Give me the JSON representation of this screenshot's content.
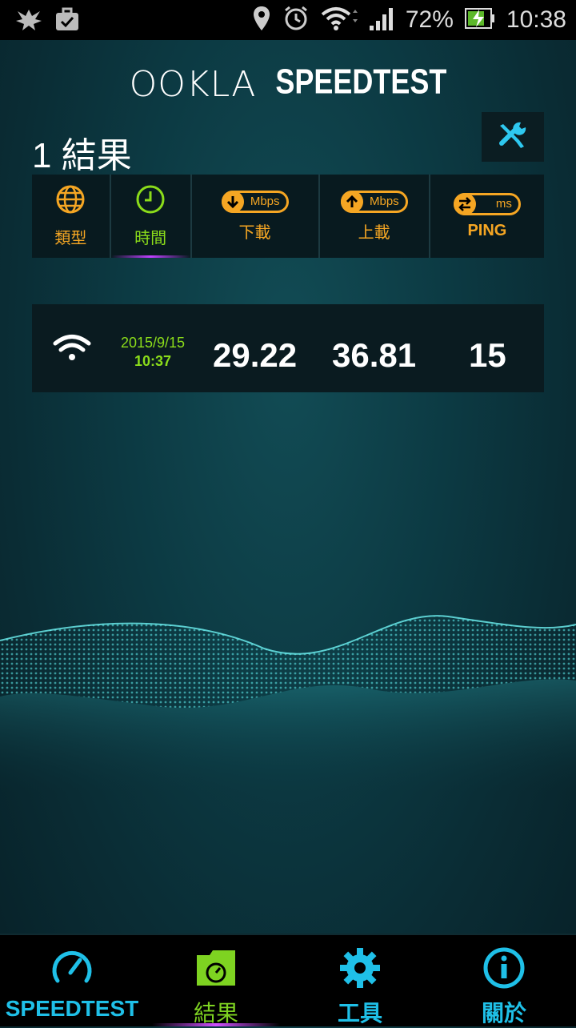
{
  "statusbar": {
    "battery": "72%",
    "time": "10:38"
  },
  "header": {
    "brand_left": "OOKLA",
    "brand_right": "SPEEDTEST"
  },
  "results": {
    "title": "1 結果"
  },
  "columns": {
    "type_label": "類型",
    "time_label": "時間",
    "download_label": "下載",
    "download_unit": "Mbps",
    "upload_label": "上載",
    "upload_unit": "Mbps",
    "ping_label": "PING",
    "ping_unit": "ms"
  },
  "rows": [
    {
      "type": "wifi-icon",
      "date": "2015/9/15",
      "time": "10:37",
      "download": "29.22",
      "upload": "36.81",
      "ping": "15"
    }
  ],
  "nav": [
    {
      "label": "SPEEDTEST",
      "icon": "speedometer-icon"
    },
    {
      "label": "結果",
      "icon": "results-folder-icon"
    },
    {
      "label": "工具",
      "icon": "gear-icon"
    },
    {
      "label": "關於",
      "icon": "info-icon"
    }
  ],
  "colors": {
    "accent_orange": "#f5a623",
    "accent_green": "#8bdc1a",
    "accent_cyan": "#1fc0e8"
  }
}
